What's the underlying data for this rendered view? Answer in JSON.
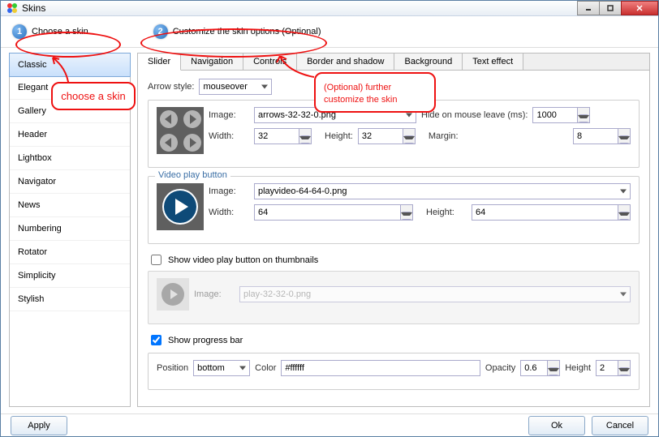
{
  "window": {
    "title": "Skins"
  },
  "steps": {
    "step1": "Choose a skin",
    "step2": "Customize the skin options (Optional)"
  },
  "annotations": {
    "choose": "choose a skin",
    "customize_line1": "(Optional) further",
    "customize_line2": "customize the skin"
  },
  "skins": {
    "items": [
      "Classic",
      "Elegant",
      "Gallery",
      "Header",
      "Lightbox",
      "Navigator",
      "News",
      "Numbering",
      "Rotator",
      "Simplicity",
      "Stylish"
    ],
    "selected_index": 0
  },
  "tabs": {
    "items": [
      "Slider",
      "Navigation",
      "Controls",
      "Border and shadow",
      "Background",
      "Text effect"
    ],
    "active_index": 0
  },
  "slider": {
    "arrow_style_label": "Arrow style:",
    "arrow_style_value": "mouseover",
    "arrows_group": {
      "image_label": "Image:",
      "image_value": "arrows-32-32-0.png",
      "hide_label": "Hide on mouse leave (ms):",
      "hide_value": "1000",
      "width_label": "Width:",
      "width_value": "32",
      "height_label": "Height:",
      "height_value": "32",
      "margin_label": "Margin:",
      "margin_value": "8"
    },
    "video_group": {
      "title": "Video play button",
      "image_label": "Image:",
      "image_value": "playvideo-64-64-0.png",
      "width_label": "Width:",
      "width_value": "64",
      "height_label": "Height:",
      "height_value": "64"
    },
    "thumb_check": {
      "label": "Show video play button on thumbnails",
      "checked": false,
      "image_label": "Image:",
      "image_value": "play-32-32-0.png"
    },
    "progress": {
      "label": "Show progress bar",
      "checked": true,
      "position_label": "Position",
      "position_value": "bottom",
      "color_label": "Color",
      "color_value": "#ffffff",
      "opacity_label": "Opacity",
      "opacity_value": "0.6",
      "height_label": "Height",
      "height_value": "2"
    }
  },
  "buttons": {
    "apply": "Apply",
    "ok": "Ok",
    "cancel": "Cancel"
  }
}
